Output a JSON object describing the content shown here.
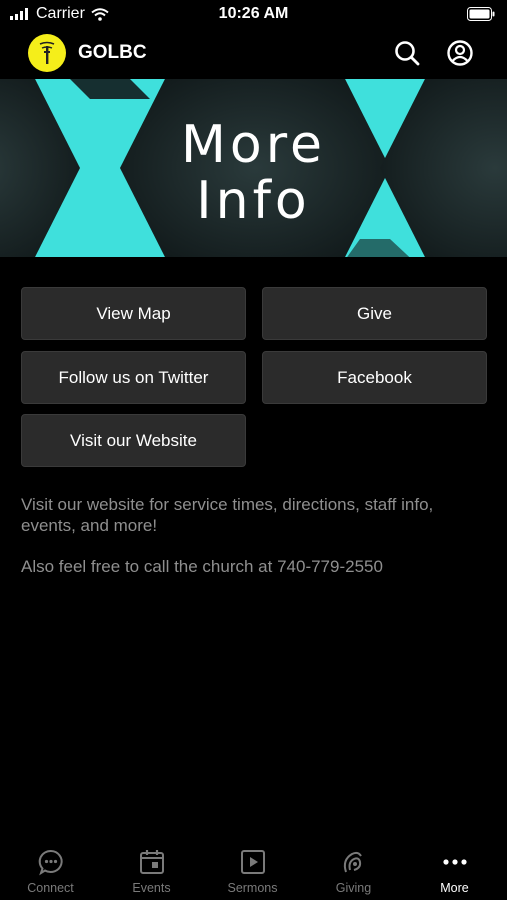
{
  "status_bar": {
    "carrier": "Carrier",
    "time": "10:26 AM"
  },
  "header": {
    "title": "GOLBC"
  },
  "banner": {
    "line1": "More",
    "line2": "Info"
  },
  "buttons": {
    "view_map": "View Map",
    "give": "Give",
    "twitter": "Follow us on Twitter",
    "facebook": "Facebook",
    "website": "Visit our Website"
  },
  "info": {
    "paragraph1": "Visit our website for service times, directions, staff info, events, and more!",
    "paragraph2": "Also feel free to call the church at 740-779-2550"
  },
  "tabs": [
    {
      "label": "Connect",
      "icon": "chat-bubble-icon"
    },
    {
      "label": "Events",
      "icon": "calendar-icon"
    },
    {
      "label": "Sermons",
      "icon": "play-icon"
    },
    {
      "label": "Giving",
      "icon": "giving-icon"
    },
    {
      "label": "More",
      "icon": "more-dots-icon"
    }
  ],
  "colors": {
    "logo_yellow": "#f5ee1a",
    "banner_teal": "#2fd0d0",
    "button_bg": "#2b2b2b",
    "info_text": "#8f8f8f"
  }
}
